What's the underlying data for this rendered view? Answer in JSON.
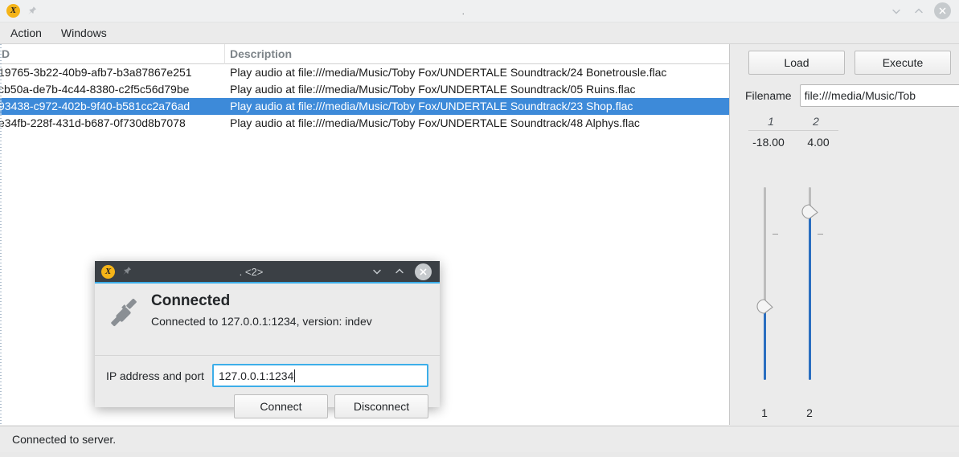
{
  "window": {
    "title": ".",
    "app_icon": "x-app-icon",
    "controls": {
      "minimize": "⌄",
      "maximize": "⌃",
      "close": "✕"
    }
  },
  "menubar": {
    "items": [
      {
        "label": "Action"
      },
      {
        "label": "Windows"
      }
    ]
  },
  "table": {
    "columns": [
      {
        "key": "id",
        "label": "D"
      },
      {
        "key": "description",
        "label": "Description"
      }
    ],
    "rows": [
      {
        "id": "19765-3b22-40b9-afb7-b3a87867e251",
        "description": "Play audio at file:///media/Music/Toby Fox/UNDERTALE Soundtrack/24 Bonetrousle.flac",
        "selected": false
      },
      {
        "id": "cb50a-de7b-4c44-8380-c2f5c56d79be",
        "description": "Play audio at file:///media/Music/Toby Fox/UNDERTALE Soundtrack/05 Ruins.flac",
        "selected": false
      },
      {
        "id": "93438-c972-402b-9f40-b581cc2a76ad",
        "description": "Play audio at file:///media/Music/Toby Fox/UNDERTALE Soundtrack/23 Shop.flac",
        "selected": true
      },
      {
        "id": "e34fb-228f-431d-b687-0f730d8b7078",
        "description": "Play audio at file:///media/Music/Toby Fox/UNDERTALE Soundtrack/48 Alphys.flac",
        "selected": false
      }
    ]
  },
  "right_panel": {
    "load_label": "Load",
    "execute_label": "Execute",
    "filename_label": "Filename",
    "filename_value": "file:///media/Music/Tob",
    "params": [
      {
        "header": "1",
        "value": "-18.00",
        "slider_label": "1",
        "fill_percent": 38
      },
      {
        "header": "2",
        "value": "4.00",
        "slider_label": "2",
        "fill_percent": 87
      }
    ]
  },
  "statusbar": {
    "text": "Connected to server."
  },
  "dialog": {
    "title": ". <2>",
    "app_icon": "x-app-icon",
    "controls": {
      "minimize": "⌄",
      "maximize": "⌃",
      "close": "✕"
    },
    "icon": "plug-connector-icon",
    "heading": "Connected",
    "subtext": "Connected to 127.0.0.1:1234, version: indev",
    "field_label": "IP address and port",
    "field_value": "127.0.0.1:1234",
    "connect_label": "Connect",
    "disconnect_label": "Disconnect"
  },
  "colors": {
    "selection_blue": "#3d8ad9",
    "accent_blue": "#3daee9",
    "slider_blue": "#2a6ec0",
    "titlebar_dark": "#3b4045",
    "app_icon_yellow": "#f5b418"
  }
}
